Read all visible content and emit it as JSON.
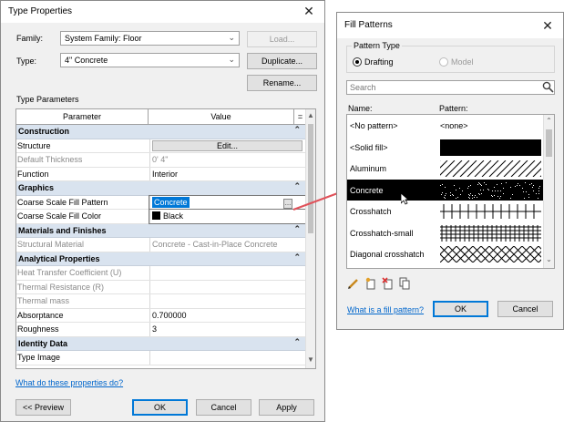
{
  "type_properties": {
    "title": "Type Properties",
    "family_label": "Family:",
    "family_value": "System Family: Floor",
    "type_label": "Type:",
    "type_value": "4\" Concrete",
    "load_button": "Load...",
    "duplicate_button": "Duplicate...",
    "rename_button": "Rename...",
    "type_parameters_label": "Type Parameters",
    "col_parameter": "Parameter",
    "col_value": "Value",
    "col_extra": "=",
    "rows": [
      {
        "kind": "group",
        "name": "Construction"
      },
      {
        "kind": "button",
        "name": "Structure",
        "value": "Edit..."
      },
      {
        "kind": "gray",
        "name": "Default Thickness",
        "value": "0'  4\""
      },
      {
        "kind": "row",
        "name": "Function",
        "value": "Interior"
      },
      {
        "kind": "group",
        "name": "Graphics"
      },
      {
        "kind": "selected",
        "name": "Coarse Scale Fill Pattern",
        "value": "Concrete"
      },
      {
        "kind": "swatch",
        "name": "Coarse Scale Fill Color",
        "value": "Black"
      },
      {
        "kind": "group",
        "name": "Materials and Finishes"
      },
      {
        "kind": "gray",
        "name": "Structural Material",
        "value": "Concrete - Cast-in-Place Concrete"
      },
      {
        "kind": "group",
        "name": "Analytical Properties"
      },
      {
        "kind": "gray",
        "name": "Heat Transfer Coefficient (U)",
        "value": ""
      },
      {
        "kind": "gray",
        "name": "Thermal Resistance (R)",
        "value": ""
      },
      {
        "kind": "gray",
        "name": "Thermal mass",
        "value": ""
      },
      {
        "kind": "row",
        "name": "Absorptance",
        "value": "0.700000"
      },
      {
        "kind": "row",
        "name": "Roughness",
        "value": "3"
      },
      {
        "kind": "group",
        "name": "Identity Data"
      },
      {
        "kind": "row",
        "name": "Type Image",
        "value": ""
      }
    ],
    "help_link": "What do these properties do?",
    "preview_button": "<< Preview",
    "ok_button": "OK",
    "cancel_button": "Cancel",
    "apply_button": "Apply"
  },
  "fill_patterns": {
    "title": "Fill Patterns",
    "pattern_type_label": "Pattern Type",
    "drafting_label": "Drafting",
    "model_label": "Model",
    "search_placeholder": "Search",
    "col_name": "Name:",
    "col_pattern": "Pattern:",
    "patterns": [
      {
        "name": "<No pattern>",
        "pattern": "none",
        "label": "<none>"
      },
      {
        "name": "<Solid fill>",
        "pattern": "solid",
        "label": ""
      },
      {
        "name": "Aluminum",
        "pattern": "diagonal-wide",
        "label": ""
      },
      {
        "name": "Concrete",
        "pattern": "concrete",
        "label": "",
        "selected": true
      },
      {
        "name": "Crosshatch",
        "pattern": "crosshatch",
        "label": ""
      },
      {
        "name": "Crosshatch-small",
        "pattern": "crosshatch-small",
        "label": ""
      },
      {
        "name": "Diagonal crosshatch",
        "pattern": "diagonal-crosshatch",
        "label": ""
      }
    ],
    "help_link": "What is a fill pattern?",
    "ok_button": "OK",
    "cancel_button": "Cancel"
  },
  "colors": {
    "selection": "#0078d7",
    "group_row": "#d9e3ef",
    "arrow": "#e0525a",
    "link": "#0066cc"
  }
}
